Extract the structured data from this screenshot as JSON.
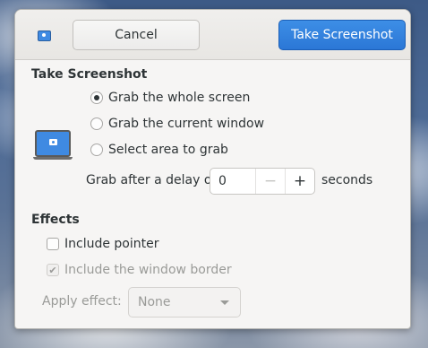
{
  "header": {
    "cancel_label": "Cancel",
    "take_label": "Take Screenshot",
    "icon": "camera-app-icon"
  },
  "take_screenshot": {
    "title": "Take Screenshot",
    "options": [
      {
        "label": "Grab the whole screen",
        "selected": true
      },
      {
        "label": "Grab the current window",
        "selected": false
      },
      {
        "label": "Select area to grab",
        "selected": false
      }
    ],
    "delay_label": "Grab after a delay of",
    "delay_value": "0",
    "delay_minus": "−",
    "delay_plus": "+",
    "delay_unit": "seconds"
  },
  "effects": {
    "title": "Effects",
    "include_pointer_label": "Include pointer",
    "include_pointer_checked": false,
    "include_border_label": "Include the window border",
    "include_border_checked": true,
    "include_border_enabled": false,
    "apply_effect_label": "Apply effect:",
    "apply_effect_value": "None"
  },
  "colors": {
    "accent": "#2b77d6",
    "window_bg": "#f6f5f4",
    "text": "#2e3436",
    "disabled_text": "#9a9b98"
  }
}
